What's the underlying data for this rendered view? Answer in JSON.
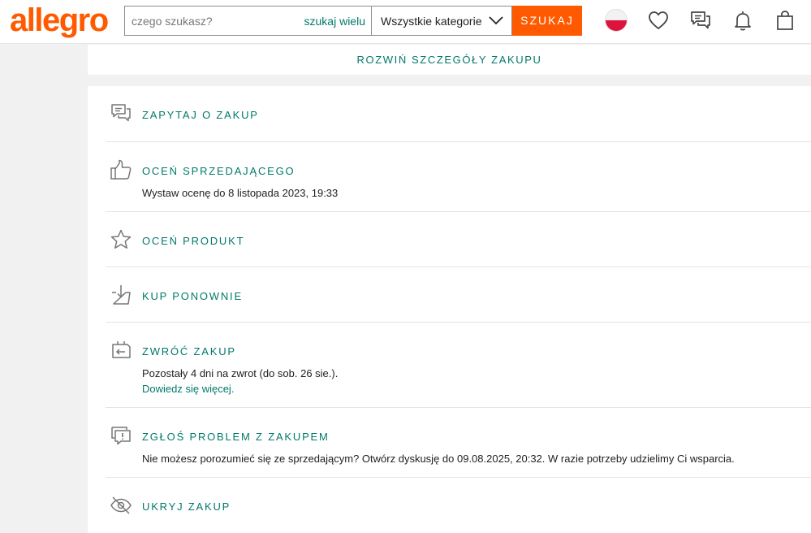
{
  "header": {
    "logo": "allegro",
    "search": {
      "placeholder": "czego szukasz?",
      "value": "",
      "many_label": "szukaj wielu"
    },
    "category": {
      "selected": "Wszystkie kategorie"
    },
    "search_button": "SZUKAJ",
    "icons": [
      "poland-flag-icon",
      "heart-icon",
      "messages-icon",
      "bell-icon",
      "shopping-bag-icon"
    ]
  },
  "expand_label": "ROZWIŃ SZCZEGÓŁY ZAKUPU",
  "actions": [
    {
      "icon": "chat-bubbles-icon",
      "title": "ZAPYTAJ O ZAKUP"
    },
    {
      "icon": "thumbs-up-icon",
      "title": "OCEŃ SPRZEDAJĄCEGO",
      "desc": "Wystaw ocenę do 8 listopada 2023, 19:33"
    },
    {
      "icon": "star-icon",
      "title": "OCEŃ PRODUKT"
    },
    {
      "icon": "basket-download-icon",
      "title": "KUP PONOWNIE"
    },
    {
      "icon": "return-icon",
      "title": "ZWRÓĆ ZAKUP",
      "desc": "Pozostały 4 dni na zwrot (do sob. 26 sie.).",
      "link": "Dowiedz się więcej."
    },
    {
      "icon": "problem-report-icon",
      "title": "ZGŁOŚ PROBLEM Z ZAKUPEM",
      "desc": "Nie możesz porozumieć się ze sprzedającym? Otwórz dyskusję do 09.08.2025, 20:32. W razie potrzeby udzielimy Ci wsparcia."
    },
    {
      "icon": "eye-hidden-icon",
      "title": "UKRYJ ZAKUP"
    }
  ],
  "colors": {
    "brand": "#ff5a00",
    "link": "#00796b",
    "icon": "#767676"
  }
}
